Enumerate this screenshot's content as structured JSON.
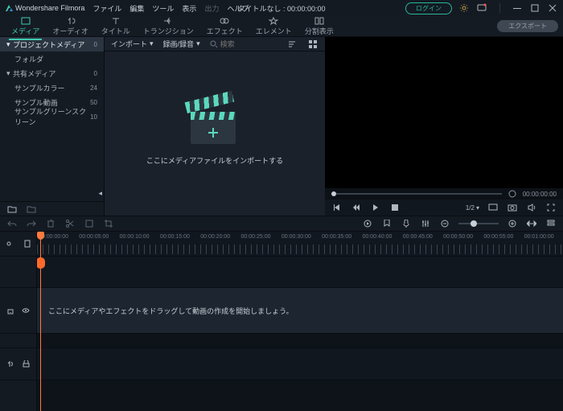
{
  "titlebar": {
    "app": "Wondershare Filmora",
    "menu": [
      "ファイル",
      "編集",
      "ツール",
      "表示",
      "出力",
      "ヘルプ"
    ],
    "center": "タイトルなし : 00:00:00:00",
    "login": "ログイン"
  },
  "tabs": {
    "items": [
      "メディア",
      "オーディオ",
      "タイトル",
      "トランジション",
      "エフェクト",
      "エレメント",
      "分割表示"
    ],
    "export": "エクスポート"
  },
  "sidebar": {
    "project": {
      "label": "プロジェクトメディア",
      "count": "0"
    },
    "folder": "フォルダ",
    "shared": {
      "label": "共有メディア",
      "count": "0"
    },
    "items": [
      {
        "label": "サンプルカラー",
        "count": "24"
      },
      {
        "label": "サンプル動画",
        "count": "50"
      },
      {
        "label": "サンプルグリーンスクリーン",
        "count": "10"
      }
    ]
  },
  "content": {
    "import": "インポート",
    "record": "録画/録音",
    "search_placeholder": "検索",
    "center": "ここにメディアファイルをインポートする"
  },
  "preview": {
    "timecode_end": "00:00:00:00",
    "ratio": "1/2"
  },
  "ruler": {
    "labels": [
      "00:00:00:00",
      "00:00:05:00",
      "00:00:10:00",
      "00:00:15:00",
      "00:00:20:00",
      "00:00:25:00",
      "00:00:30:00",
      "00:00:35:00",
      "00:00:40:00",
      "00:00:45:00",
      "00:00:50:00",
      "00:00:55:00",
      "00:01:00:00"
    ]
  },
  "timeline": {
    "hint": "ここにメディアやエフェクトをドラッグして動画の作成を開始しましょう。"
  }
}
